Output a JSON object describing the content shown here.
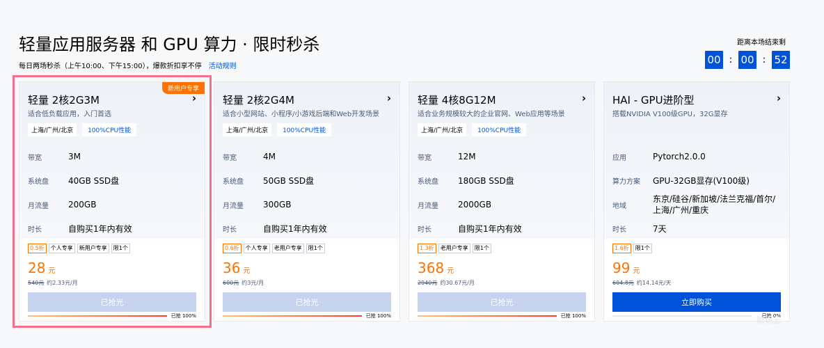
{
  "header": {
    "title": "轻量应用服务器 和 GPU 算力 · 限时秒杀",
    "subtitle": "每日两场秒杀（上午10:00、下午15:00），爆款折扣享不停",
    "rules_link": "活动规则"
  },
  "countdown": {
    "label": "距离本场结束剩",
    "hours": "00",
    "minutes": "00",
    "seconds": "52",
    "sep": ":"
  },
  "colors": {
    "accent": "#0052d9",
    "price": "#ff7200",
    "highlight_border": "#f4708e"
  },
  "cards": [
    {
      "ribbon": "新用户专享",
      "name": "轻量 2核2G3M",
      "desc": "适合低负载应用，入门首选",
      "region": "上海/广州/北京",
      "cpu_tag": "100%CPU性能",
      "specs": [
        {
          "k": "带宽",
          "v": "3M"
        },
        {
          "k": "系统盘",
          "v": "40GB SSD盘"
        },
        {
          "k": "月流量",
          "v": "200GB"
        },
        {
          "k": "时长",
          "v": "自购买1年内有效"
        }
      ],
      "discount": "0.5折",
      "badges": [
        "个人专享",
        "新用户专享",
        "限1个"
      ],
      "price": "28",
      "unit": "元",
      "orig_price": "540元",
      "per": "约2.33元/月",
      "button": "已抢光",
      "sold_out": true,
      "progress": 100,
      "progress_label": "已抢 100%"
    },
    {
      "name": "轻量 2核2G4M",
      "desc": "适合小型网站、小程序/小游戏后端和Web开发场景",
      "region": "上海/广州/北京",
      "cpu_tag": "100%CPU性能",
      "specs": [
        {
          "k": "带宽",
          "v": "4M"
        },
        {
          "k": "系统盘",
          "v": "50GB SSD盘"
        },
        {
          "k": "月流量",
          "v": "300GB"
        },
        {
          "k": "时长",
          "v": "自购买1年内有效"
        }
      ],
      "discount": "0.6折",
      "badges": [
        "个人专享",
        "老用户专享",
        "限1个"
      ],
      "price": "36",
      "unit": "元",
      "orig_price": "600元",
      "per": "约3元/月",
      "button": "已抢光",
      "sold_out": true,
      "progress": 100,
      "progress_label": "已抢 100%"
    },
    {
      "name": "轻量 4核8G12M",
      "desc": "适合业务规模较大的企业官网、Web应用等场景",
      "region": "上海/广州/北京",
      "cpu_tag": "100%CPU性能",
      "specs": [
        {
          "k": "带宽",
          "v": "12M"
        },
        {
          "k": "系统盘",
          "v": "180GB SSD盘"
        },
        {
          "k": "月流量",
          "v": "2000GB"
        },
        {
          "k": "时长",
          "v": "自购买1年内有效"
        }
      ],
      "discount": "1.3折",
      "badges": [
        "老用户专享",
        "限1个"
      ],
      "price": "368",
      "unit": "元",
      "orig_price": "2940元",
      "per": "约30.67元/月",
      "button": "已抢光",
      "sold_out": true,
      "progress": 100,
      "progress_label": "已抢 100%"
    },
    {
      "name": "HAI - GPU进阶型",
      "desc": "搭载NVIDIA V100级GPU，32G显存",
      "specs": [
        {
          "k": "应用",
          "v": "Pytorch2.0.0"
        },
        {
          "k": "算力方案",
          "v": "GPU-32GB显存(V100级)"
        },
        {
          "k": "地域",
          "v": "东京/硅谷/新加坡/法兰克福/首尔/上海/广州/重庆"
        },
        {
          "k": "时长",
          "v": "7天"
        }
      ],
      "discount": "1.6折",
      "badges": [
        "限1个"
      ],
      "price": "99",
      "unit": "元",
      "orig_price": "604.8元",
      "per": "约14.14元/天",
      "button": "立即购买",
      "sold_out": false,
      "progress": 0,
      "progress_label": "已抢 0%"
    }
  ],
  "watermark": "腾讯云"
}
